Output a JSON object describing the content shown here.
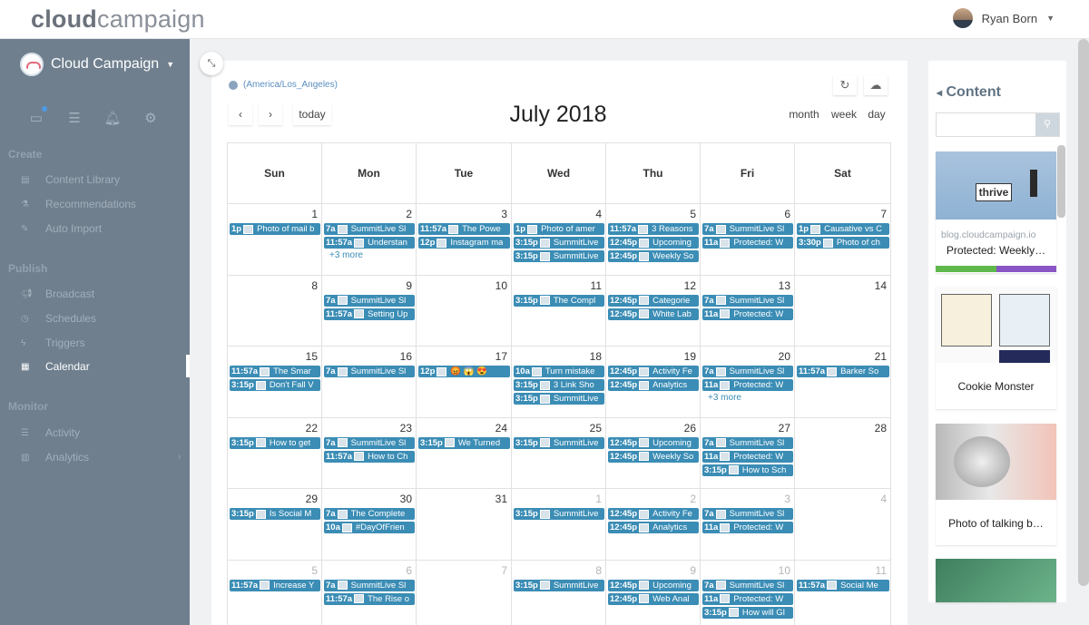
{
  "header": {
    "logo_bold": "cloud",
    "logo_rest": "campaign",
    "user_name": "Ryan Born"
  },
  "sidebar": {
    "brand": "Cloud Campaign",
    "icons": [
      "laptop-icon",
      "list-icon",
      "bell-icon",
      "gear-icon"
    ],
    "sections": [
      {
        "title": "Create",
        "items": [
          {
            "label": "Content Library",
            "icon": "book-icon"
          },
          {
            "label": "Recommendations",
            "icon": "lab-icon"
          },
          {
            "label": "Auto Import",
            "icon": "magic-icon"
          }
        ]
      },
      {
        "title": "Publish",
        "items": [
          {
            "label": "Broadcast",
            "icon": "megaphone-icon"
          },
          {
            "label": "Schedules",
            "icon": "clock-icon"
          },
          {
            "label": "Triggers",
            "icon": "bolt-icon"
          },
          {
            "label": "Calendar",
            "icon": "calendar-icon"
          }
        ]
      },
      {
        "title": "Monitor",
        "items": [
          {
            "label": "Activity",
            "icon": "list-icon"
          },
          {
            "label": "Analytics",
            "icon": "chart-icon"
          }
        ]
      }
    ]
  },
  "calendar": {
    "timezone": "(America/Los_Angeles)",
    "title": "July 2018",
    "today_label": "today",
    "views": [
      "month",
      "week",
      "day"
    ],
    "dow": [
      "Sun",
      "Mon",
      "Tue",
      "Wed",
      "Thu",
      "Fri",
      "Sat"
    ],
    "weeks": [
      {
        "days": [
          "1",
          "2",
          "3",
          "4",
          "5",
          "6",
          "7"
        ],
        "other": []
      },
      {
        "days": [
          "8",
          "9",
          "10",
          "11",
          "12",
          "13",
          "14"
        ],
        "other": []
      },
      {
        "days": [
          "15",
          "16",
          "17",
          "18",
          "19",
          "20",
          "21"
        ],
        "other": []
      },
      {
        "days": [
          "22",
          "23",
          "24",
          "25",
          "26",
          "27",
          "28"
        ],
        "other": []
      },
      {
        "days": [
          "29",
          "30",
          "31",
          "1",
          "2",
          "3",
          "4"
        ],
        "other": [
          3,
          4,
          5,
          6
        ]
      },
      {
        "days": [
          "5",
          "6",
          "7",
          "8",
          "9",
          "10",
          "11"
        ],
        "other": [
          0,
          1,
          2,
          3,
          4,
          5,
          6
        ]
      }
    ],
    "events": [
      {
        "w": 0,
        "d": 0,
        "r": 0,
        "t": "1p",
        "title": "Photo of mail b"
      },
      {
        "w": 0,
        "d": 1,
        "r": 0,
        "t": "7a",
        "title": "SummitLive Sl"
      },
      {
        "w": 0,
        "d": 1,
        "r": 1,
        "t": "11:57a",
        "title": "Understan"
      },
      {
        "w": 0,
        "d": 2,
        "r": 0,
        "t": "11:57a",
        "title": "The Powe"
      },
      {
        "w": 0,
        "d": 2,
        "r": 1,
        "t": "12p",
        "title": "Instagram ma"
      },
      {
        "w": 0,
        "d": 3,
        "r": 0,
        "t": "1p",
        "title": "Photo of amer"
      },
      {
        "w": 0,
        "d": 3,
        "r": 1,
        "t": "3:15p",
        "title": "SummitLive"
      },
      {
        "w": 0,
        "d": 3,
        "r": 2,
        "t": "3:15p",
        "title": "SummitLive"
      },
      {
        "w": 0,
        "d": 4,
        "r": 0,
        "t": "11:57a",
        "title": "3 Reasons"
      },
      {
        "w": 0,
        "d": 4,
        "r": 1,
        "t": "12:45p",
        "title": "Upcoming"
      },
      {
        "w": 0,
        "d": 4,
        "r": 2,
        "t": "12:45p",
        "title": "Weekly So"
      },
      {
        "w": 0,
        "d": 5,
        "r": 0,
        "t": "7a",
        "title": "SummitLive Sl"
      },
      {
        "w": 0,
        "d": 5,
        "r": 1,
        "t": "11a",
        "title": "Protected: W"
      },
      {
        "w": 0,
        "d": 6,
        "r": 0,
        "t": "1p",
        "title": "Causative vs C"
      },
      {
        "w": 0,
        "d": 6,
        "r": 1,
        "t": "3:30p",
        "title": "Photo of ch"
      },
      {
        "w": 1,
        "d": 1,
        "r": 0,
        "t": "7a",
        "title": "SummitLive Sl"
      },
      {
        "w": 1,
        "d": 1,
        "r": 1,
        "t": "11:57a",
        "title": "Setting Up"
      },
      {
        "w": 1,
        "d": 3,
        "r": 0,
        "t": "3:15p",
        "title": "The Compl"
      },
      {
        "w": 1,
        "d": 4,
        "r": 0,
        "t": "12:45p",
        "title": "Categorie"
      },
      {
        "w": 1,
        "d": 4,
        "r": 1,
        "t": "12:45p",
        "title": "White Lab"
      },
      {
        "w": 1,
        "d": 5,
        "r": 0,
        "t": "7a",
        "title": "SummitLive Sl"
      },
      {
        "w": 1,
        "d": 5,
        "r": 1,
        "t": "11a",
        "title": "Protected: W"
      },
      {
        "w": 2,
        "d": 0,
        "r": 0,
        "t": "11:57a",
        "title": "The Smar"
      },
      {
        "w": 2,
        "d": 0,
        "r": 1,
        "t": "3:15p",
        "title": "Don't Fall V"
      },
      {
        "w": 2,
        "d": 1,
        "r": 0,
        "t": "7a",
        "title": "SummitLive Sl"
      },
      {
        "w": 2,
        "d": 2,
        "r": 0,
        "t": "12p",
        "title": "😡 😱 😍"
      },
      {
        "w": 2,
        "d": 3,
        "r": 0,
        "t": "10a",
        "title": "Turn mistake"
      },
      {
        "w": 2,
        "d": 3,
        "r": 1,
        "t": "3:15p",
        "title": "3 Link Sho"
      },
      {
        "w": 2,
        "d": 3,
        "r": 2,
        "t": "3:15p",
        "title": "SummitLive"
      },
      {
        "w": 2,
        "d": 4,
        "r": 0,
        "t": "12:45p",
        "title": "Activity Fe"
      },
      {
        "w": 2,
        "d": 4,
        "r": 1,
        "t": "12:45p",
        "title": "Analytics"
      },
      {
        "w": 2,
        "d": 5,
        "r": 0,
        "t": "7a",
        "title": "SummitLive Sl"
      },
      {
        "w": 2,
        "d": 5,
        "r": 1,
        "t": "11a",
        "title": "Protected: W"
      },
      {
        "w": 2,
        "d": 6,
        "r": 0,
        "t": "11:57a",
        "title": "Barker So"
      },
      {
        "w": 3,
        "d": 0,
        "r": 0,
        "t": "3:15p",
        "title": "How to get"
      },
      {
        "w": 3,
        "d": 1,
        "r": 0,
        "t": "7a",
        "title": "SummitLive Sl"
      },
      {
        "w": 3,
        "d": 1,
        "r": 1,
        "t": "11:57a",
        "title": "How to Ch"
      },
      {
        "w": 3,
        "d": 2,
        "r": 0,
        "t": "3:15p",
        "title": "We Turned"
      },
      {
        "w": 3,
        "d": 3,
        "r": 0,
        "t": "3:15p",
        "title": "SummitLive"
      },
      {
        "w": 3,
        "d": 4,
        "r": 0,
        "t": "12:45p",
        "title": "Upcoming"
      },
      {
        "w": 3,
        "d": 4,
        "r": 1,
        "t": "12:45p",
        "title": "Weekly So"
      },
      {
        "w": 3,
        "d": 5,
        "r": 0,
        "t": "7a",
        "title": "SummitLive Sl"
      },
      {
        "w": 3,
        "d": 5,
        "r": 1,
        "t": "11a",
        "title": "Protected: W"
      },
      {
        "w": 3,
        "d": 5,
        "r": 2,
        "t": "3:15p",
        "title": "How to Sch"
      },
      {
        "w": 4,
        "d": 0,
        "r": 0,
        "t": "3:15p",
        "title": "Is Social M"
      },
      {
        "w": 4,
        "d": 1,
        "r": 0,
        "t": "7a",
        "title": "The Complete"
      },
      {
        "w": 4,
        "d": 1,
        "r": 1,
        "t": "10a",
        "title": "#DayOfFrien"
      },
      {
        "w": 4,
        "d": 3,
        "r": 0,
        "t": "3:15p",
        "title": "SummitLive"
      },
      {
        "w": 4,
        "d": 4,
        "r": 0,
        "t": "12:45p",
        "title": "Activity Fe"
      },
      {
        "w": 4,
        "d": 4,
        "r": 1,
        "t": "12:45p",
        "title": "Analytics"
      },
      {
        "w": 4,
        "d": 5,
        "r": 0,
        "t": "7a",
        "title": "SummitLive Sl"
      },
      {
        "w": 4,
        "d": 5,
        "r": 1,
        "t": "11a",
        "title": "Protected: W"
      },
      {
        "w": 5,
        "d": 0,
        "r": 0,
        "t": "11:57a",
        "title": "Increase Y"
      },
      {
        "w": 5,
        "d": 1,
        "r": 0,
        "t": "7a",
        "title": "SummitLive Sl"
      },
      {
        "w": 5,
        "d": 1,
        "r": 1,
        "t": "11:57a",
        "title": "The Rise o"
      },
      {
        "w": 5,
        "d": 3,
        "r": 0,
        "t": "3:15p",
        "title": "SummitLive"
      },
      {
        "w": 5,
        "d": 4,
        "r": 0,
        "t": "12:45p",
        "title": "Upcoming"
      },
      {
        "w": 5,
        "d": 4,
        "r": 1,
        "t": "12:45p",
        "title": "Web Anal"
      },
      {
        "w": 5,
        "d": 5,
        "r": 0,
        "t": "7a",
        "title": "SummitLive Sl"
      },
      {
        "w": 5,
        "d": 5,
        "r": 1,
        "t": "11a",
        "title": "Protected: W"
      },
      {
        "w": 5,
        "d": 5,
        "r": 2,
        "t": "3:15p",
        "title": "How will Gl"
      },
      {
        "w": 5,
        "d": 6,
        "r": 0,
        "t": "11:57a",
        "title": "Social Me"
      }
    ],
    "more_links": [
      {
        "w": 0,
        "d": 1,
        "r": 2,
        "label": "+3 more"
      },
      {
        "w": 2,
        "d": 5,
        "r": 2,
        "label": "+3 more"
      }
    ]
  },
  "content_panel": {
    "title": "Content",
    "cards": [
      {
        "domain": "blog.cloudcampaign.io",
        "text": "Protected: Weekly…",
        "image_text": "thrive"
      },
      {
        "domain": "",
        "text": "Cookie Monster"
      },
      {
        "domain": "",
        "text": "Photo of talking b…"
      },
      {
        "domain": "",
        "text": ""
      }
    ]
  }
}
